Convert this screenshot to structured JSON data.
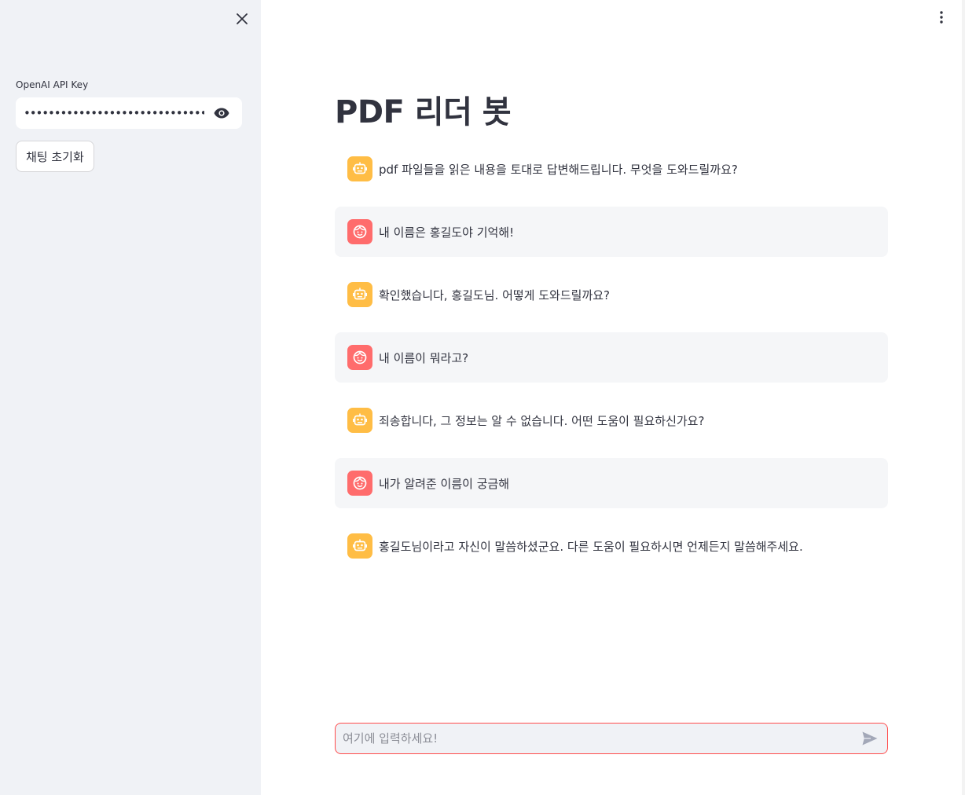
{
  "sidebar": {
    "api_key_label": "OpenAI API Key",
    "api_key_value": "••••••••••••••••••••••••••••••••••••••••••••••••••••",
    "reset_label": "채팅 초기화"
  },
  "main": {
    "title": "PDF 리더 봇",
    "messages": [
      {
        "role": "assistant",
        "text": "pdf 파일들을 읽은 내용을 토대로 답변해드립니다. 무엇을 도와드릴까요?"
      },
      {
        "role": "user",
        "text": "내 이름은 홍길도야 기억해!"
      },
      {
        "role": "assistant",
        "text": "확인했습니다, 홍길도님. 어떻게 도와드릴까요?"
      },
      {
        "role": "user",
        "text": "내 이름이 뭐라고?"
      },
      {
        "role": "assistant",
        "text": "죄송합니다, 그 정보는 알 수 없습니다. 어떤 도움이 필요하신가요?"
      },
      {
        "role": "user",
        "text": "내가 알려준 이름이 궁금해"
      },
      {
        "role": "assistant",
        "text": "홍길도님이라고 자신이 말씀하셨군요. 다른 도움이 필요하시면 언제든지 말씀해주세요."
      }
    ],
    "input_placeholder": "여기에 입력하세요!"
  },
  "colors": {
    "accent": "#ff4b4b",
    "assistant_avatar": "#ffbd45",
    "user_avatar": "#ff6c6c",
    "sidebar_bg": "#f0f2f6"
  }
}
